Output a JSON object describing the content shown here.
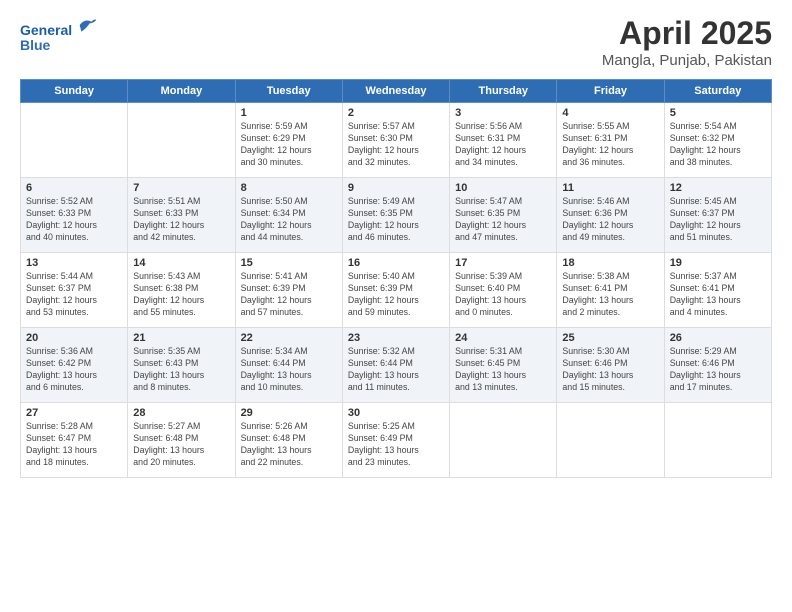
{
  "header": {
    "logo_line1": "General",
    "logo_line2": "Blue",
    "title": "April 2025",
    "subtitle": "Mangla, Punjab, Pakistan"
  },
  "days_of_week": [
    "Sunday",
    "Monday",
    "Tuesday",
    "Wednesday",
    "Thursday",
    "Friday",
    "Saturday"
  ],
  "weeks": [
    {
      "group": "row-group-1",
      "days": [
        {
          "num": "",
          "info": ""
        },
        {
          "num": "",
          "info": ""
        },
        {
          "num": "1",
          "info": "Sunrise: 5:59 AM\nSunset: 6:29 PM\nDaylight: 12 hours\nand 30 minutes."
        },
        {
          "num": "2",
          "info": "Sunrise: 5:57 AM\nSunset: 6:30 PM\nDaylight: 12 hours\nand 32 minutes."
        },
        {
          "num": "3",
          "info": "Sunrise: 5:56 AM\nSunset: 6:31 PM\nDaylight: 12 hours\nand 34 minutes."
        },
        {
          "num": "4",
          "info": "Sunrise: 5:55 AM\nSunset: 6:31 PM\nDaylight: 12 hours\nand 36 minutes."
        },
        {
          "num": "5",
          "info": "Sunrise: 5:54 AM\nSunset: 6:32 PM\nDaylight: 12 hours\nand 38 minutes."
        }
      ]
    },
    {
      "group": "row-group-2",
      "days": [
        {
          "num": "6",
          "info": "Sunrise: 5:52 AM\nSunset: 6:33 PM\nDaylight: 12 hours\nand 40 minutes."
        },
        {
          "num": "7",
          "info": "Sunrise: 5:51 AM\nSunset: 6:33 PM\nDaylight: 12 hours\nand 42 minutes."
        },
        {
          "num": "8",
          "info": "Sunrise: 5:50 AM\nSunset: 6:34 PM\nDaylight: 12 hours\nand 44 minutes."
        },
        {
          "num": "9",
          "info": "Sunrise: 5:49 AM\nSunset: 6:35 PM\nDaylight: 12 hours\nand 46 minutes."
        },
        {
          "num": "10",
          "info": "Sunrise: 5:47 AM\nSunset: 6:35 PM\nDaylight: 12 hours\nand 47 minutes."
        },
        {
          "num": "11",
          "info": "Sunrise: 5:46 AM\nSunset: 6:36 PM\nDaylight: 12 hours\nand 49 minutes."
        },
        {
          "num": "12",
          "info": "Sunrise: 5:45 AM\nSunset: 6:37 PM\nDaylight: 12 hours\nand 51 minutes."
        }
      ]
    },
    {
      "group": "row-group-3",
      "days": [
        {
          "num": "13",
          "info": "Sunrise: 5:44 AM\nSunset: 6:37 PM\nDaylight: 12 hours\nand 53 minutes."
        },
        {
          "num": "14",
          "info": "Sunrise: 5:43 AM\nSunset: 6:38 PM\nDaylight: 12 hours\nand 55 minutes."
        },
        {
          "num": "15",
          "info": "Sunrise: 5:41 AM\nSunset: 6:39 PM\nDaylight: 12 hours\nand 57 minutes."
        },
        {
          "num": "16",
          "info": "Sunrise: 5:40 AM\nSunset: 6:39 PM\nDaylight: 12 hours\nand 59 minutes."
        },
        {
          "num": "17",
          "info": "Sunrise: 5:39 AM\nSunset: 6:40 PM\nDaylight: 13 hours\nand 0 minutes."
        },
        {
          "num": "18",
          "info": "Sunrise: 5:38 AM\nSunset: 6:41 PM\nDaylight: 13 hours\nand 2 minutes."
        },
        {
          "num": "19",
          "info": "Sunrise: 5:37 AM\nSunset: 6:41 PM\nDaylight: 13 hours\nand 4 minutes."
        }
      ]
    },
    {
      "group": "row-group-4",
      "days": [
        {
          "num": "20",
          "info": "Sunrise: 5:36 AM\nSunset: 6:42 PM\nDaylight: 13 hours\nand 6 minutes."
        },
        {
          "num": "21",
          "info": "Sunrise: 5:35 AM\nSunset: 6:43 PM\nDaylight: 13 hours\nand 8 minutes."
        },
        {
          "num": "22",
          "info": "Sunrise: 5:34 AM\nSunset: 6:44 PM\nDaylight: 13 hours\nand 10 minutes."
        },
        {
          "num": "23",
          "info": "Sunrise: 5:32 AM\nSunset: 6:44 PM\nDaylight: 13 hours\nand 11 minutes."
        },
        {
          "num": "24",
          "info": "Sunrise: 5:31 AM\nSunset: 6:45 PM\nDaylight: 13 hours\nand 13 minutes."
        },
        {
          "num": "25",
          "info": "Sunrise: 5:30 AM\nSunset: 6:46 PM\nDaylight: 13 hours\nand 15 minutes."
        },
        {
          "num": "26",
          "info": "Sunrise: 5:29 AM\nSunset: 6:46 PM\nDaylight: 13 hours\nand 17 minutes."
        }
      ]
    },
    {
      "group": "row-group-5",
      "days": [
        {
          "num": "27",
          "info": "Sunrise: 5:28 AM\nSunset: 6:47 PM\nDaylight: 13 hours\nand 18 minutes."
        },
        {
          "num": "28",
          "info": "Sunrise: 5:27 AM\nSunset: 6:48 PM\nDaylight: 13 hours\nand 20 minutes."
        },
        {
          "num": "29",
          "info": "Sunrise: 5:26 AM\nSunset: 6:48 PM\nDaylight: 13 hours\nand 22 minutes."
        },
        {
          "num": "30",
          "info": "Sunrise: 5:25 AM\nSunset: 6:49 PM\nDaylight: 13 hours\nand 23 minutes."
        },
        {
          "num": "",
          "info": ""
        },
        {
          "num": "",
          "info": ""
        },
        {
          "num": "",
          "info": ""
        }
      ]
    }
  ]
}
